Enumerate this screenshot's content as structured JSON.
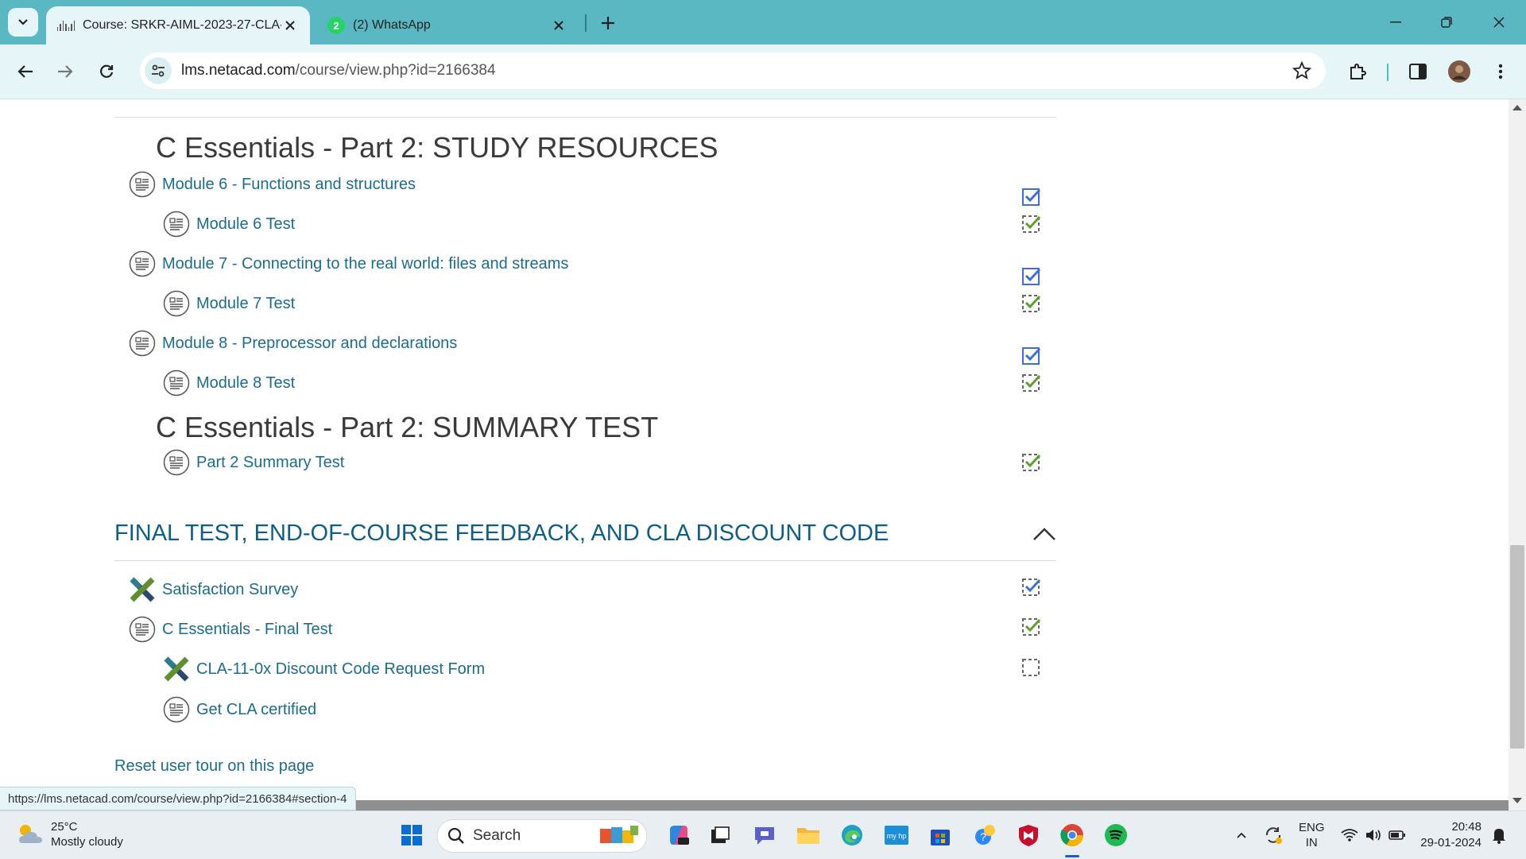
{
  "browser": {
    "tabs": [
      {
        "title": "Course: SRKR-AIML-2023-27-CLA-",
        "active": true,
        "icon": "cisco-icon"
      },
      {
        "title": "(2) WhatsApp",
        "active": false,
        "icon": "whatsapp-icon",
        "badge": "2"
      }
    ],
    "url_host": "lms.netacad.com",
    "url_path": "/course/view.php?id=2166384"
  },
  "course": {
    "study_resources_heading": "C Essentials - Part 2: STUDY RESOURCES",
    "summary_test_heading": "C Essentials - Part 2: SUMMARY TEST",
    "activities": [
      {
        "label": "Module 6 - Functions and structures",
        "icon": "page-icon",
        "completion": "checked-blue"
      },
      {
        "label": "Module 6 Test",
        "icon": "page-icon",
        "completion": "checked-green"
      },
      {
        "label": "Module 7 - Connecting to the real world: files and streams",
        "icon": "page-icon",
        "completion": "checked-blue"
      },
      {
        "label": "Module 7 Test",
        "icon": "page-icon",
        "completion": "checked-green"
      },
      {
        "label": "Module 8 - Preprocessor and declarations",
        "icon": "page-icon",
        "completion": "checked-blue"
      },
      {
        "label": "Module 8 Test",
        "icon": "page-icon",
        "completion": "checked-green"
      },
      {
        "label": "Part 2 Summary Test",
        "icon": "page-icon",
        "completion": "checked-green"
      }
    ],
    "final_section": {
      "title": "FINAL TEST, END-OF-COURSE FEEDBACK, AND CLA DISCOUNT CODE",
      "items": [
        {
          "label": "Satisfaction Survey",
          "icon": "survey-x-icon",
          "completion": "checked-blue-dashed"
        },
        {
          "label": "C Essentials - Final Test",
          "icon": "page-icon",
          "completion": "checked-green"
        },
        {
          "label": "CLA-11-0x Discount Code Request Form",
          "icon": "survey-x-icon",
          "completion": "unchecked"
        },
        {
          "label": "Get CLA certified",
          "icon": "page-icon",
          "completion": "none"
        }
      ]
    },
    "reset_link": "Reset user tour on this page"
  },
  "status_bar": {
    "url": "https://lms.netacad.com/course/view.php?id=2166384#section-4"
  },
  "taskbar": {
    "weather_temp": "25°C",
    "weather_desc": "Mostly cloudy",
    "search_label": "Search",
    "lang_line1": "ENG",
    "lang_line2": "IN",
    "time": "20:48",
    "date": "29-01-2024"
  },
  "colors": {
    "tab_strip": "#5ab8c3",
    "toolbar": "#e6f6f8",
    "link": "#1c6c8c",
    "section_title": "#0f5e88",
    "check_blue": "#3b6fd4",
    "check_green": "#5e9e2a"
  }
}
